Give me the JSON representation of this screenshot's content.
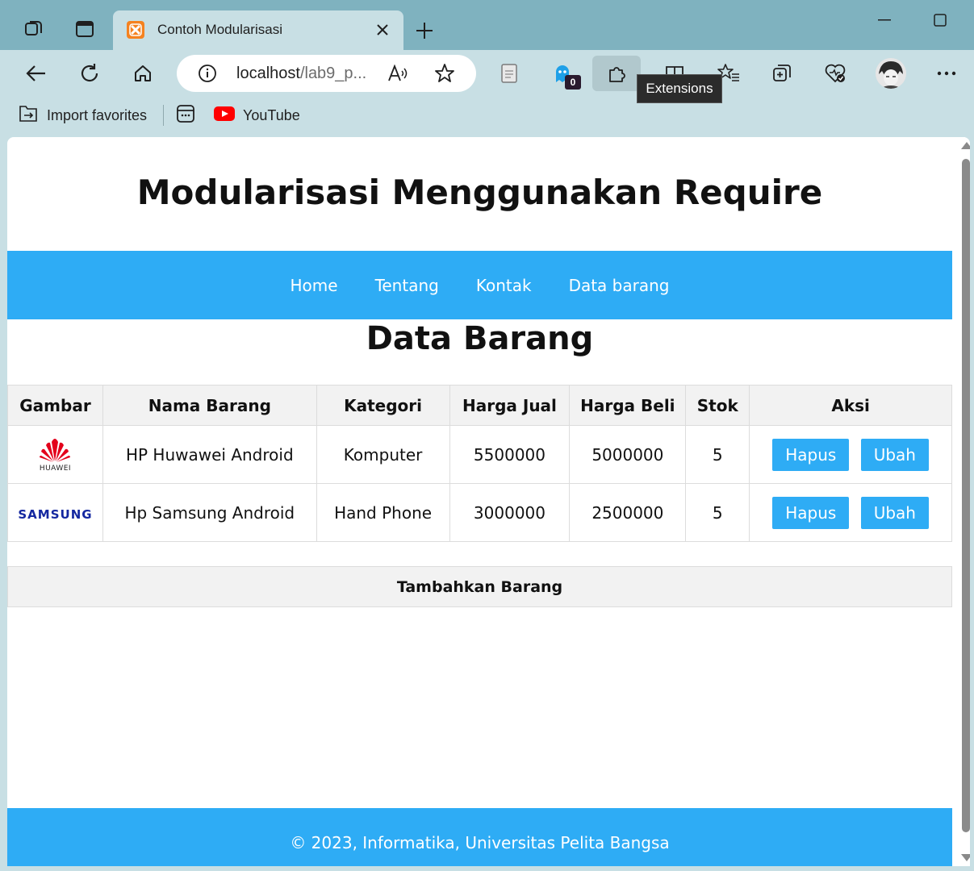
{
  "browser": {
    "tab_title": "Contoh Modularisasi",
    "address": {
      "host": "localhost",
      "path": "/lab9_p..."
    },
    "extensions_badge": "0",
    "tooltip": "Extensions",
    "bookmarks": [
      {
        "label": "Import favorites",
        "icon": "import-favorites-icon"
      },
      {
        "label": "",
        "icon": "apps-icon"
      },
      {
        "label": "YouTube",
        "icon": "youtube-icon"
      }
    ],
    "accent_colors": {
      "frame": "#7fb2bf",
      "toolbar": "#c8dfe4"
    }
  },
  "site": {
    "title": "Modularisasi Menggunakan Require",
    "nav": [
      "Home",
      "Tentang",
      "Kontak",
      "Data barang"
    ],
    "brand_color": "#2eacf5"
  },
  "main": {
    "heading": "Data Barang",
    "table": {
      "headers": [
        "Gambar",
        "Nama Barang",
        "Kategori",
        "Harga Jual",
        "Harga Beli",
        "Stok",
        "Aksi"
      ],
      "rows": [
        {
          "image": "huawei-logo",
          "image_text": "HUAWEI",
          "name": "HP Huwawei Android",
          "category": "Komputer",
          "sell": "5500000",
          "buy": "5000000",
          "stock": "5",
          "actions": [
            "Hapus",
            "Ubah"
          ]
        },
        {
          "image": "samsung-logo",
          "image_text": "SAMSUNG",
          "name": "Hp Samsung Android",
          "category": "Hand Phone",
          "sell": "3000000",
          "buy": "2500000",
          "stock": "5",
          "actions": [
            "Hapus",
            "Ubah"
          ]
        }
      ]
    },
    "add_label": "Tambahkan Barang"
  },
  "footer": {
    "text": "© 2023, Informatika, Universitas Pelita Bangsa"
  }
}
